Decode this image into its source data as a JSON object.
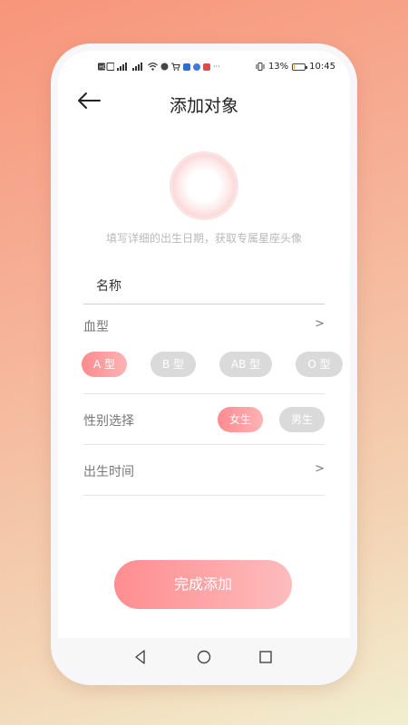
{
  "status_bar": {
    "battery_percent": "13%",
    "battery_level": 0.13,
    "time": "10:45",
    "left_icons": [
      "hd-icon",
      "signal-icon",
      "signal-4g-icon",
      "wifi-icon",
      "app-icon",
      "cart-icon",
      "app-blue-icon",
      "app-blue2-icon",
      "app-red-icon",
      "more-icon"
    ],
    "more": "···"
  },
  "header": {
    "title": "添加对象"
  },
  "avatar": {
    "hint": "填写详细的出生日期，获取专属星座头像"
  },
  "name_field": {
    "placeholder": "名称",
    "value": ""
  },
  "blood_type": {
    "label": "血型",
    "arrow": ">",
    "options": [
      "A 型",
      "B 型",
      "AB 型",
      "O 型"
    ],
    "selected": "A 型"
  },
  "gender": {
    "label": "性别选择",
    "options": [
      "女生",
      "男生"
    ],
    "selected": "女生"
  },
  "birth_time": {
    "label": "出生时间",
    "arrow": ">"
  },
  "submit": {
    "label": "完成添加"
  },
  "colors": {
    "accent_start": "#ff8d91",
    "accent_end": "#fdbcbc",
    "inactive_pill": "#dadada"
  }
}
